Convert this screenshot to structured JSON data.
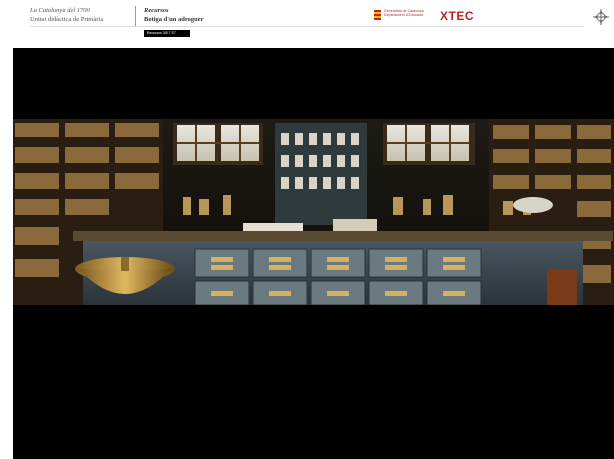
{
  "header": {
    "course_title": "La Catalunya del 1700",
    "course_subtitle": "Unitat didàctica de Primària",
    "section_label": "Recursos",
    "section_title": "Botiga d'un adroguer",
    "badge": "Recursos 3/8 7 S7",
    "gencat_text": "Generalitat de Catalunya Departament d'Educació",
    "xtec_logo": "XTEC"
  },
  "icons": {
    "nav": "compass-icon"
  },
  "colors": {
    "xtec_red": "#c41e1e",
    "viewer_bg": "#000000"
  }
}
